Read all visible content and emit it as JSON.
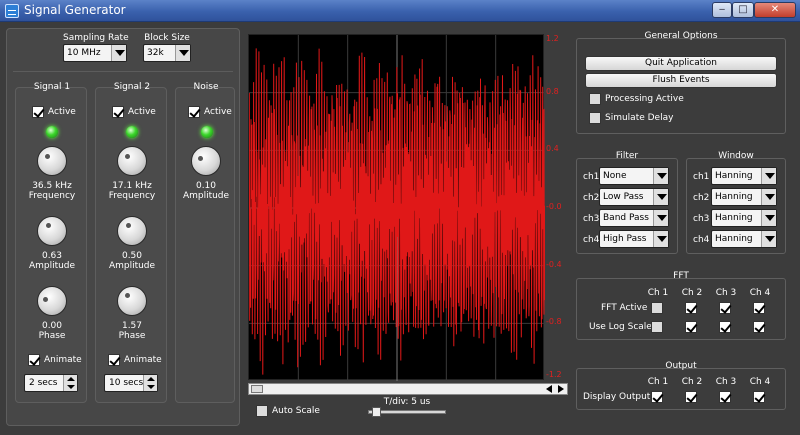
{
  "window": {
    "title": "Signal Generator",
    "min_glyph": "‒",
    "max_glyph": "□",
    "close_glyph": "✕"
  },
  "sampling": {
    "label": "Sampling Rate",
    "value": "10 MHz"
  },
  "block": {
    "label": "Block Size",
    "value": "32k"
  },
  "signals": [
    {
      "title": "Signal 1",
      "active_label": "Active",
      "active": true,
      "freq_value": "36.5 kHz",
      "freq_label": "Frequency",
      "amp_value": "0.63",
      "amp_label": "Amplitude",
      "phase_value": "0.00",
      "phase_label": "Phase",
      "animate_label": "Animate",
      "animate": true,
      "duration": "2 secs"
    },
    {
      "title": "Signal 2",
      "active_label": "Active",
      "active": true,
      "freq_value": "17.1 kHz",
      "freq_label": "Frequency",
      "amp_value": "0.50",
      "amp_label": "Amplitude",
      "phase_value": "1.57",
      "phase_label": "Phase",
      "animate_label": "Animate",
      "animate": true,
      "duration": "10 secs"
    }
  ],
  "noise": {
    "title": "Noise",
    "active_label": "Active",
    "active": true,
    "amp_value": "0.10",
    "amp_label": "Amplitude"
  },
  "scope": {
    "y_ticks": [
      "1.2",
      "0.8",
      "0.4",
      "-0.0",
      "-0.4",
      "-0.8",
      "-1.2"
    ],
    "auto_scale_label": "Auto Scale",
    "tdiv_label": "T/div: 5 us",
    "trace_color": "#e01818"
  },
  "general": {
    "title": "General Options",
    "quit_label": "Quit Application",
    "flush_label": "Flush Events",
    "processing_label": "Processing Active",
    "simulate_label": "Simulate Delay"
  },
  "filter": {
    "title": "Filter",
    "rows": [
      {
        "ch": "ch1",
        "value": "None"
      },
      {
        "ch": "ch2",
        "value": "Low Pass"
      },
      {
        "ch": "ch3",
        "value": "Band Pass"
      },
      {
        "ch": "ch4",
        "value": "High Pass"
      }
    ]
  },
  "window_fn": {
    "title": "Window",
    "rows": [
      {
        "ch": "ch1",
        "value": "Hanning"
      },
      {
        "ch": "ch2",
        "value": "Hanning"
      },
      {
        "ch": "ch3",
        "value": "Hanning"
      },
      {
        "ch": "ch4",
        "value": "Hanning"
      }
    ]
  },
  "fft": {
    "title": "FFT",
    "channels": [
      "Ch 1",
      "Ch 2",
      "Ch 3",
      "Ch 4"
    ],
    "active_label": "FFT Active",
    "log_label": "Use Log Scale",
    "active": [
      false,
      true,
      true,
      true
    ],
    "log": [
      false,
      true,
      true,
      true
    ]
  },
  "output": {
    "title": "Output",
    "channels": [
      "Ch 1",
      "Ch 2",
      "Ch 3",
      "Ch 4"
    ],
    "display_label": "Display Output",
    "display": [
      true,
      true,
      true,
      true
    ]
  }
}
